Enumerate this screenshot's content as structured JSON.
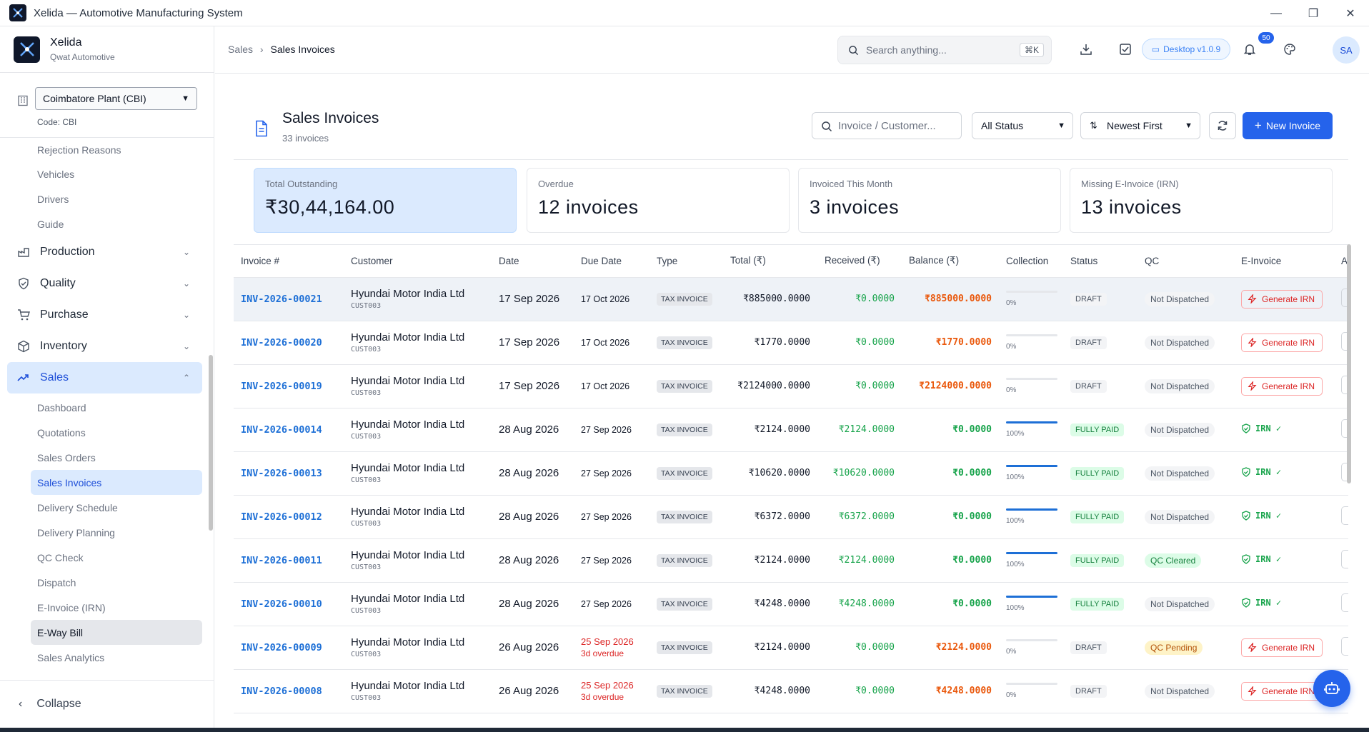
{
  "window": {
    "title": "Xelida — Automotive Manufacturing System"
  },
  "brand": {
    "name": "Xelida",
    "subtitle": "Qwat Automotive"
  },
  "plant": {
    "selected": "Coimbatore Plant (CBI)",
    "code": "Code: CBI"
  },
  "sidebar": {
    "pre_items": [
      "Rejection Reasons",
      "Vehicles",
      "Drivers",
      "Guide"
    ],
    "groups": [
      {
        "label": "Production",
        "icon": "production-icon"
      },
      {
        "label": "Quality",
        "icon": "shield-icon"
      },
      {
        "label": "Purchase",
        "icon": "cart-icon"
      },
      {
        "label": "Inventory",
        "icon": "box-icon"
      },
      {
        "label": "Sales",
        "icon": "trend-icon"
      }
    ],
    "sales_items": [
      "Dashboard",
      "Quotations",
      "Sales Orders",
      "Sales Invoices",
      "Delivery Schedule",
      "Delivery Planning",
      "QC Check",
      "Dispatch",
      "E-Invoice (IRN)",
      "E-Way Bill",
      "Sales Analytics"
    ],
    "collapse_label": "Collapse"
  },
  "topbar": {
    "breadcrumb_parent": "Sales",
    "breadcrumb_sep": "›",
    "breadcrumb_current": "Sales Invoices",
    "search_placeholder": "Search anything...",
    "search_shortcut": "⌘K",
    "version": "Desktop v1.0.9",
    "notifications": "50",
    "avatar": "SA"
  },
  "page": {
    "title": "Sales Invoices",
    "subtitle": "33 invoices",
    "search_placeholder": "Invoice / Customer...",
    "status_filter": "All Status",
    "sort": "Newest First",
    "new_button": "New Invoice"
  },
  "stats": [
    {
      "label": "Total Outstanding",
      "value": "₹30,44,164.00"
    },
    {
      "label": "Overdue",
      "value": "12 invoices"
    },
    {
      "label": "Invoiced This Month",
      "value": "3 invoices"
    },
    {
      "label": "Missing E-Invoice (IRN)",
      "value": "13 invoices"
    }
  ],
  "table": {
    "headers": [
      "Invoice #",
      "Customer",
      "Date",
      "Due Date",
      "Type",
      "Total (₹)",
      "Received (₹)",
      "Balance (₹)",
      "Collection",
      "Status",
      "QC",
      "E-Invoice",
      "A"
    ],
    "rows": [
      {
        "inv": "INV-2026-00021",
        "cust": "Hyundai Motor India Ltd",
        "code": "CUST003",
        "date": "17 Sep 2026",
        "due": "17 Oct 2026",
        "overdue": "",
        "type": "TAX INVOICE",
        "total": "₹885000.0000",
        "recv": "₹0.0000",
        "bal": "₹885000.0000",
        "pct": "0%",
        "progress": 0,
        "status": "DRAFT",
        "qc": "Not Dispatched",
        "einv": "Generate IRN",
        "irn": false
      },
      {
        "inv": "INV-2026-00020",
        "cust": "Hyundai Motor India Ltd",
        "code": "CUST003",
        "date": "17 Sep 2026",
        "due": "17 Oct 2026",
        "overdue": "",
        "type": "TAX INVOICE",
        "total": "₹1770.0000",
        "recv": "₹0.0000",
        "bal": "₹1770.0000",
        "pct": "0%",
        "progress": 0,
        "status": "DRAFT",
        "qc": "Not Dispatched",
        "einv": "Generate IRN",
        "irn": false
      },
      {
        "inv": "INV-2026-00019",
        "cust": "Hyundai Motor India Ltd",
        "code": "CUST003",
        "date": "17 Sep 2026",
        "due": "17 Oct 2026",
        "overdue": "",
        "type": "TAX INVOICE",
        "total": "₹2124000.0000",
        "recv": "₹0.0000",
        "bal": "₹2124000.0000",
        "pct": "0%",
        "progress": 0,
        "status": "DRAFT",
        "qc": "Not Dispatched",
        "einv": "Generate IRN",
        "irn": false
      },
      {
        "inv": "INV-2026-00014",
        "cust": "Hyundai Motor India Ltd",
        "code": "CUST003",
        "date": "28 Aug 2026",
        "due": "27 Sep 2026",
        "overdue": "",
        "type": "TAX INVOICE",
        "total": "₹2124.0000",
        "recv": "₹2124.0000",
        "bal": "₹0.0000",
        "pct": "100%",
        "progress": 100,
        "status": "FULLY PAID",
        "qc": "Not Dispatched",
        "einv": "IRN ✓",
        "irn": true
      },
      {
        "inv": "INV-2026-00013",
        "cust": "Hyundai Motor India Ltd",
        "code": "CUST003",
        "date": "28 Aug 2026",
        "due": "27 Sep 2026",
        "overdue": "",
        "type": "TAX INVOICE",
        "total": "₹10620.0000",
        "recv": "₹10620.0000",
        "bal": "₹0.0000",
        "pct": "100%",
        "progress": 100,
        "status": "FULLY PAID",
        "qc": "Not Dispatched",
        "einv": "IRN ✓",
        "irn": true
      },
      {
        "inv": "INV-2026-00012",
        "cust": "Hyundai Motor India Ltd",
        "code": "CUST003",
        "date": "28 Aug 2026",
        "due": "27 Sep 2026",
        "overdue": "",
        "type": "TAX INVOICE",
        "total": "₹6372.0000",
        "recv": "₹6372.0000",
        "bal": "₹0.0000",
        "pct": "100%",
        "progress": 100,
        "status": "FULLY PAID",
        "qc": "Not Dispatched",
        "einv": "IRN ✓",
        "irn": true
      },
      {
        "inv": "INV-2026-00011",
        "cust": "Hyundai Motor India Ltd",
        "code": "CUST003",
        "date": "28 Aug 2026",
        "due": "27 Sep 2026",
        "overdue": "",
        "type": "TAX INVOICE",
        "total": "₹2124.0000",
        "recv": "₹2124.0000",
        "bal": "₹0.0000",
        "pct": "100%",
        "progress": 100,
        "status": "FULLY PAID",
        "qc": "QC Cleared",
        "einv": "IRN ✓",
        "irn": true
      },
      {
        "inv": "INV-2026-00010",
        "cust": "Hyundai Motor India Ltd",
        "code": "CUST003",
        "date": "28 Aug 2026",
        "due": "27 Sep 2026",
        "overdue": "",
        "type": "TAX INVOICE",
        "total": "₹4248.0000",
        "recv": "₹4248.0000",
        "bal": "₹0.0000",
        "pct": "100%",
        "progress": 100,
        "status": "FULLY PAID",
        "qc": "Not Dispatched",
        "einv": "IRN ✓",
        "irn": true
      },
      {
        "inv": "INV-2026-00009",
        "cust": "Hyundai Motor India Ltd",
        "code": "CUST003",
        "date": "26 Aug 2026",
        "due": "25 Sep 2026",
        "overdue": "3d overdue",
        "type": "TAX INVOICE",
        "total": "₹2124.0000",
        "recv": "₹0.0000",
        "bal": "₹2124.0000",
        "pct": "0%",
        "progress": 0,
        "status": "DRAFT",
        "qc": "QC Pending",
        "einv": "Generate IRN",
        "irn": false
      },
      {
        "inv": "INV-2026-00008",
        "cust": "Hyundai Motor India Ltd",
        "code": "CUST003",
        "date": "26 Aug 2026",
        "due": "25 Sep 2026",
        "overdue": "3d overdue",
        "type": "TAX INVOICE",
        "total": "₹4248.0000",
        "recv": "₹0.0000",
        "bal": "₹4248.0000",
        "pct": "0%",
        "progress": 0,
        "status": "DRAFT",
        "qc": "Not Dispatched",
        "einv": "Generate IRN",
        "irn": false
      }
    ]
  },
  "colors": {
    "accent": "#2563eb",
    "link": "#1d6fd6",
    "positive": "#16a34a",
    "balance": "#ea580c",
    "overdue": "#dc2626"
  }
}
